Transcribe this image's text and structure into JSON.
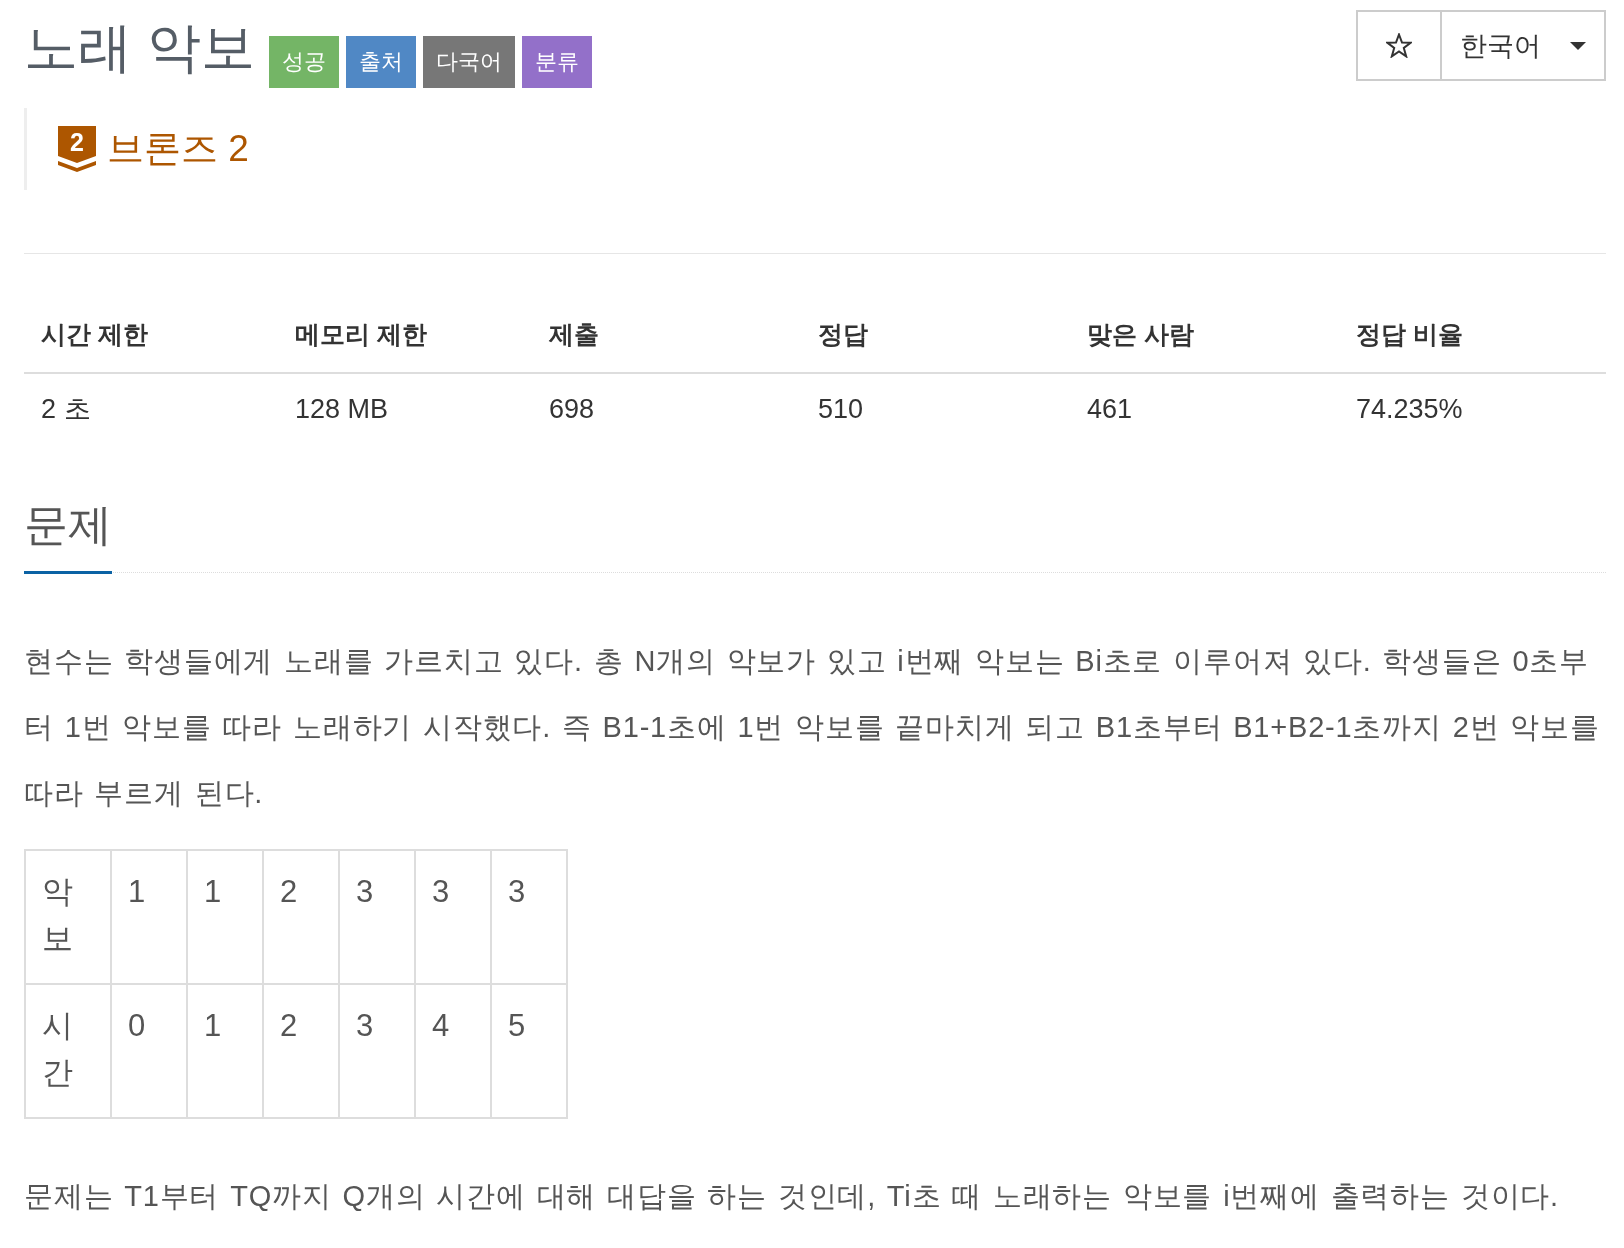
{
  "title": "노래 악보",
  "labels": [
    {
      "text": "성공",
      "color": "#74b566"
    },
    {
      "text": "출처",
      "color": "#5088c5"
    },
    {
      "text": "다국어",
      "color": "#777777"
    },
    {
      "text": "분류",
      "color": "#9370c9"
    }
  ],
  "language": "한국어",
  "tier": {
    "badge": "2",
    "name": "브론즈 2"
  },
  "stats": {
    "columns": [
      "시간 제한",
      "메모리 제한",
      "제출",
      "정답",
      "맞은 사람",
      "정답 비율"
    ],
    "rows": [
      [
        "2 초",
        "128 MB",
        "698",
        "510",
        "461",
        "74.235%"
      ]
    ]
  },
  "section": {
    "title": "문제"
  },
  "paragraphs": [
    "현수는 학생들에게 노래를 가르치고 있다. 총 N개의 악보가 있고 i번째 악보는 Bi초로 이루어져 있다. 학생들은 0초부터 1번 악보를 따라 노래하기 시작했다. 즉 B1-1초에 1번 악보를 끝마치게 되고 B1초부터 B1+B2-1초까지 2번 악보를 따라 부르게 된다."
  ],
  "example_table": {
    "rows": [
      {
        "header": "악보",
        "cells": [
          "1",
          "1",
          "2",
          "3",
          "3",
          "3"
        ]
      },
      {
        "header": "시간",
        "cells": [
          "0",
          "1",
          "2",
          "3",
          "4",
          "5"
        ]
      }
    ]
  },
  "closing": "문제는 T1부터 TQ까지 Q개의 시간에 대해 대답을 하는 것인데, Ti초 때 노래하는 악보를 i번째에 출력하는 것이다."
}
